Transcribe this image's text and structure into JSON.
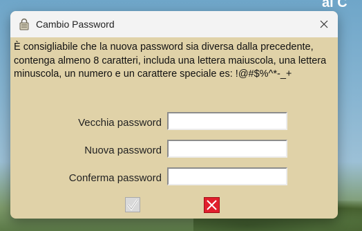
{
  "background": {
    "caption": "al C"
  },
  "dialog": {
    "title": "Cambio Password",
    "message": "È consigliabile che la nuova password sia diversa dalla precedente, contenga almeno 8 caratteri, includa una lettera maiuscola, una lettera minuscola, un numero e un carattere speciale es: !@#$%^*-_+",
    "fields": {
      "old_password": {
        "label": "Vecchia password",
        "value": ""
      },
      "new_password": {
        "label": "Nuova password",
        "value": ""
      },
      "confirm_password": {
        "label": "Conferma password",
        "value": ""
      }
    },
    "icons": {
      "app": "padlock-icon",
      "close": "close-icon",
      "confirm": "checkmark-icon",
      "cancel": "x-icon"
    },
    "colors": {
      "dialog_bg": "#e0d2a8",
      "titlebar_bg": "#f3f3f3",
      "cancel_red": "#e11f2d",
      "confirm_gray": "#d9d9d9"
    }
  }
}
